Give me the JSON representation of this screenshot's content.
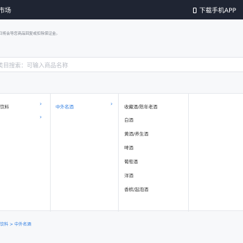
{
  "header": {
    "title": "市场",
    "download_app": "下载手机APP"
  },
  "notice": "日将会导您商品回复或扣除保证金。",
  "search": {
    "placeholder": "类目搜索：可输入商品名称"
  },
  "categories": {
    "level1": [
      {
        "label": "饮料",
        "arrow": "›"
      },
      {
        "label": "",
        "arrow": "›"
      }
    ],
    "level2": [
      {
        "label": "中外名酒",
        "arrow": "›"
      }
    ],
    "level3": [
      {
        "label": "收藏酒/陈年老酒"
      },
      {
        "label": "白酒"
      },
      {
        "label": "黄酒/养生酒"
      },
      {
        "label": "啤酒"
      },
      {
        "label": "葡萄酒"
      },
      {
        "label": "洋酒"
      },
      {
        "label": "香槟/起泡酒"
      }
    ]
  },
  "breadcrumb": "饮料 > 中外名酒",
  "colors": {
    "header_bg": "#1f2533",
    "accent": "#2f7de1"
  }
}
